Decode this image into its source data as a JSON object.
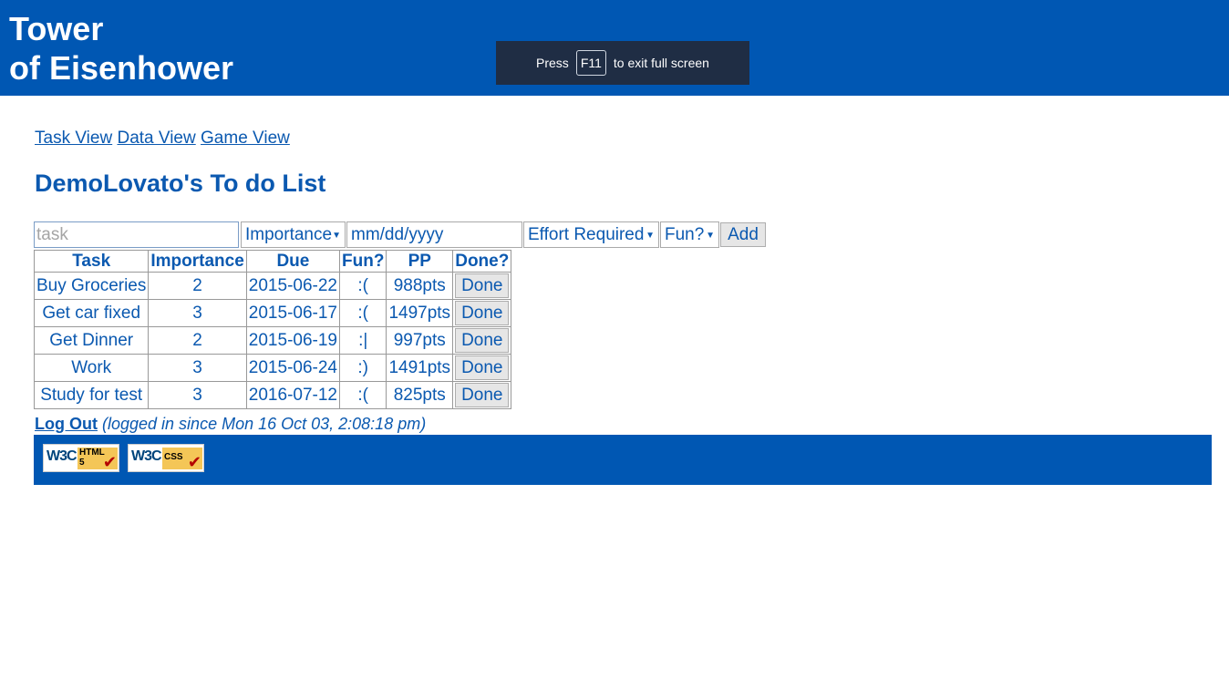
{
  "header": {
    "title_line1": "Tower",
    "title_line2": "of Eisenhower",
    "fullscreen_notice": {
      "pre": "Press",
      "key": "F11",
      "post": "to exit full screen"
    }
  },
  "nav": {
    "links": [
      "Task View",
      "Data View",
      "Game View"
    ]
  },
  "page_title": "DemoLovato's To do List",
  "form": {
    "task_placeholder": "task",
    "importance_label": "Importance",
    "date_placeholder": "mm/dd/yyyy",
    "effort_label": "Effort Required",
    "fun_label": "Fun?",
    "add_label": "Add"
  },
  "table": {
    "headers": [
      "Task",
      "Importance",
      "Due",
      "Fun?",
      "PP",
      "Done?"
    ],
    "rows": [
      {
        "task": "Buy Groceries",
        "importance": "2",
        "due": "2015-06-22",
        "fun": ":(",
        "pp": "988pts",
        "done": "Done"
      },
      {
        "task": "Get car fixed",
        "importance": "3",
        "due": "2015-06-17",
        "fun": ":(",
        "pp": "1497pts",
        "done": "Done"
      },
      {
        "task": "Get Dinner",
        "importance": "2",
        "due": "2015-06-19",
        "fun": ":|",
        "pp": "997pts",
        "done": "Done"
      },
      {
        "task": "Work",
        "importance": "3",
        "due": "2015-06-24",
        "fun": ":)",
        "pp": "1491pts",
        "done": "Done"
      },
      {
        "task": "Study for test",
        "importance": "3",
        "due": "2016-07-12",
        "fun": ":(",
        "pp": "825pts",
        "done": "Done"
      }
    ]
  },
  "status": {
    "logout": "Log Out",
    "since": "(logged in since Mon 16 Oct 03, 2:08:18 pm)"
  },
  "footer": {
    "badges": [
      {
        "org": "W3C",
        "tag_line1": "HTML",
        "tag_line2": "5"
      },
      {
        "org": "W3C",
        "tag_line1": "CSS",
        "tag_line2": ""
      }
    ]
  },
  "colors": {
    "brand_blue": "#0057b3",
    "text_blue": "#0b59b0",
    "toast_bg": "#1f2d44"
  }
}
